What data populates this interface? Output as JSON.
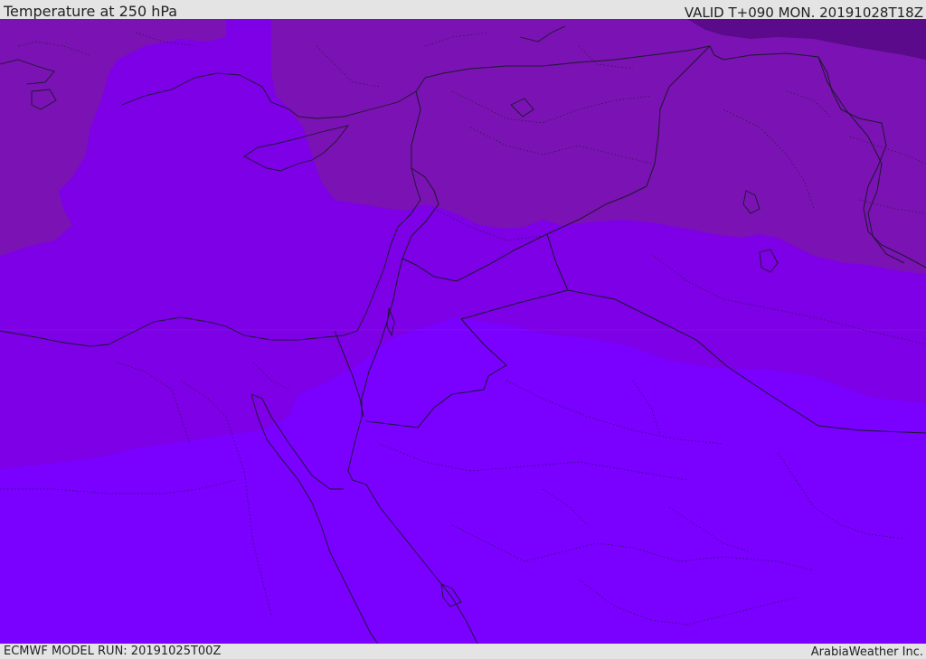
{
  "header": {
    "title": "Temperature at 250 hPa",
    "valid_time": "VALID T+090 MON. 20191028T18Z"
  },
  "footer": {
    "model_run": "ECMWF MODEL RUN: 20191025T00Z",
    "credit": "ArabiaWeather Inc."
  },
  "map": {
    "field": "temperature",
    "level": "250 hPa",
    "colors": {
      "coldest_band": "#5a0a8a",
      "cold_band": "#7b12b3",
      "mid_band": "#7d00e6",
      "warm_band": "#7a00ff",
      "border_line": "#1a1a2a",
      "top_bar": "#e4e4e4"
    }
  }
}
